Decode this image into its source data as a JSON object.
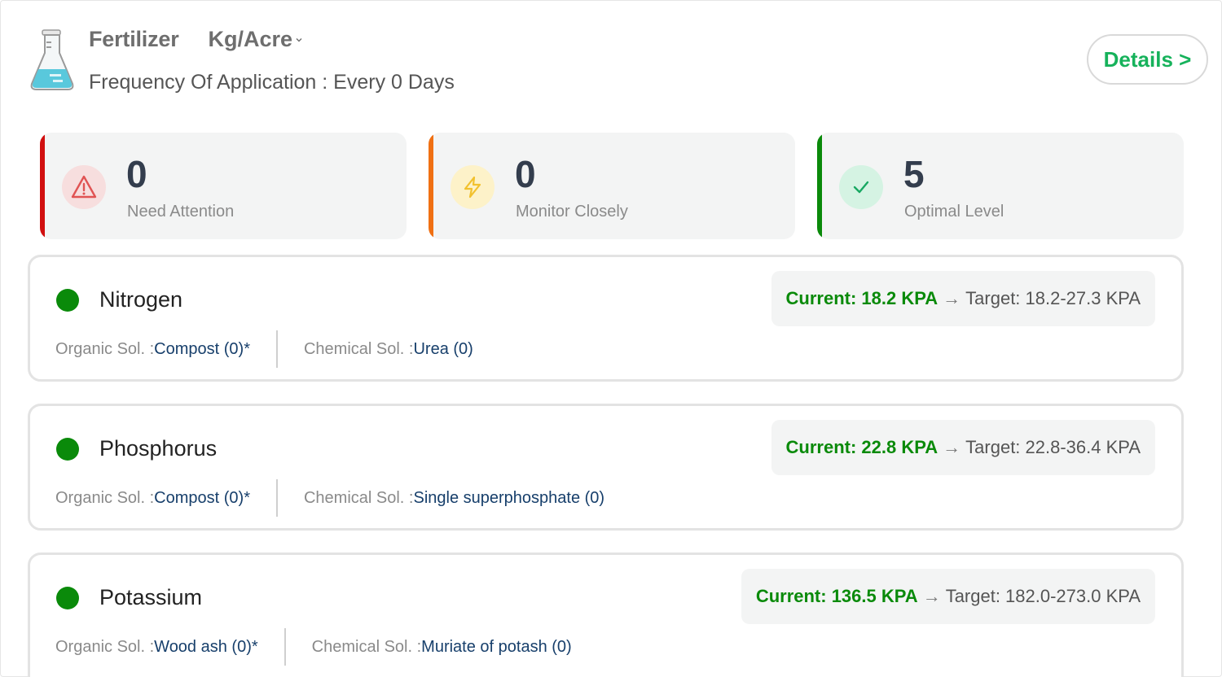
{
  "header": {
    "title": "Fertilizer",
    "unit": "Kg/Acre",
    "frequency_label": "Frequency Of Application : ",
    "frequency_value": "Every 0 Days",
    "details_label": "Details >",
    "icon": "flask-icon"
  },
  "status": [
    {
      "count": "0",
      "label": "Need Attention",
      "icon": "warning-icon",
      "bar_color": "#d10f0f",
      "icon_bg": "#f7dede",
      "icon_color": "#e05353"
    },
    {
      "count": "0",
      "label": "Monitor Closely",
      "icon": "bolt-icon",
      "bar_color": "#f07013",
      "icon_bg": "#fdf2c9",
      "icon_color": "#f2c12e"
    },
    {
      "count": "5",
      "label": "Optimal Level",
      "icon": "check-icon",
      "bar_color": "#0a8a0a",
      "icon_bg": "#d5f3e3",
      "icon_color": "#18a862"
    }
  ],
  "nutrients": [
    {
      "name": "Nitrogen",
      "organic_label": "Organic Sol. : ",
      "organic_value": "Compost (0)*",
      "chemical_label": "Chemical Sol. : ",
      "chemical_value": "Urea (0)",
      "current": "Current: 18.2 KPA",
      "arrow": "→",
      "target": "Target: 18.2-27.3 KPA",
      "status_color": "#0a8a0a"
    },
    {
      "name": "Phosphorus",
      "organic_label": "Organic Sol. : ",
      "organic_value": "Compost (0)*",
      "chemical_label": "Chemical Sol. : ",
      "chemical_value": "Single superphosphate (0)",
      "current": "Current: 22.8 KPA",
      "arrow": "→",
      "target": "Target: 22.8-36.4 KPA",
      "status_color": "#0a8a0a"
    },
    {
      "name": "Potassium",
      "organic_label": "Organic Sol. : ",
      "organic_value": "Wood ash (0)*",
      "chemical_label": "Chemical Sol. : ",
      "chemical_value": "Muriate of potash (0)",
      "current": "Current: 136.5 KPA",
      "arrow": "→",
      "target": "Target: 182.0-273.0 KPA",
      "status_color": "#0a8a0a"
    }
  ]
}
